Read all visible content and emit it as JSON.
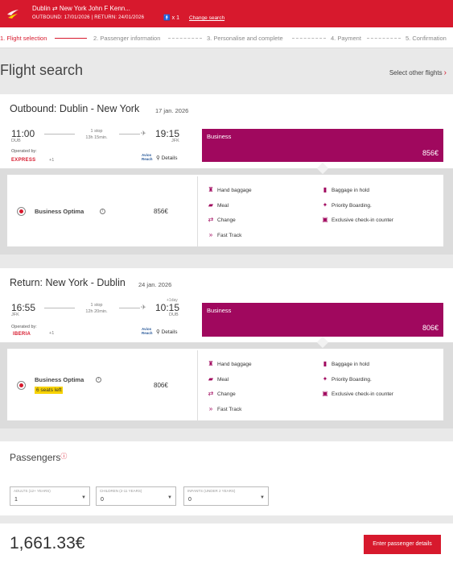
{
  "header": {
    "route": "Dublin ⇄ New York John F Kenn...",
    "dates": "OUTBOUND: 17/01/2026 | RETURN: 24/01/2026",
    "pax": "x 1",
    "change_search": "Change search"
  },
  "steps": [
    {
      "label": "1. Flight selection",
      "active": true
    },
    {
      "label": "2. Passenger information",
      "active": false
    },
    {
      "label": "3. Personalise and complete",
      "active": false
    },
    {
      "label": "4. Payment",
      "active": false
    },
    {
      "label": "5. Confirmation",
      "active": false
    }
  ],
  "page_title": "Flight search",
  "select_other": "Select other flights",
  "outbound": {
    "title": "Outbound: Dublin - New York",
    "date": "17 jan. 2026",
    "dep_time": "11:00",
    "dep_apt": "DUB",
    "arr_time": "19:15",
    "arr_apt": "JFK",
    "stops": "1 stop",
    "duration": "13h 15min.",
    "operated_by": "Operated by:",
    "airline": "EXPRESS",
    "plus": "+1",
    "avios": "Avios",
    "avios_sub": "Reach",
    "details": "Details",
    "cabin": "Business",
    "cabin_price": "856€",
    "fare_name": "Business Optima",
    "fare_price": "856€"
  },
  "return": {
    "title": "Return: New York - Dublin",
    "date": "24 jan. 2026",
    "dep_time": "16:55",
    "dep_apt": "JFK",
    "arr_time": "10:15",
    "arr_apt": "DUB",
    "plus_day": "+1day",
    "stops": "1 stop",
    "duration": "12h 20min.",
    "operated_by": "Operated by:",
    "airline": "IBERIA",
    "plus": "+1",
    "avios": "Avios",
    "avios_sub": "Reach",
    "details": "Details",
    "cabin": "Business",
    "cabin_price": "806€",
    "fare_name": "Business Optima",
    "seats_left": "6 seats left",
    "fare_price": "806€"
  },
  "features": {
    "hand_baggage": "Hand baggage",
    "meal": "Meal",
    "change": "Change",
    "fast_track": "Fast Track",
    "baggage_hold": "Baggage in hold",
    "priority": "Priority Boarding.",
    "checkin": "Exclusive check-in counter"
  },
  "passengers": {
    "title": "Passengers",
    "adults_label": "ADULTS (12+ YEARS)",
    "adults_value": "1",
    "children_label": "CHILDREN (2-11 YEARS)",
    "children_value": "0",
    "infants_label": "INFANTS (UNDER 2 YEARS)",
    "infants_value": "0"
  },
  "total": "1,661.33€",
  "cta": "Enter passenger details",
  "colors": {
    "brand_red": "#d7192d",
    "business_purple": "#a0085e",
    "seats_yellow": "#f7d200"
  }
}
